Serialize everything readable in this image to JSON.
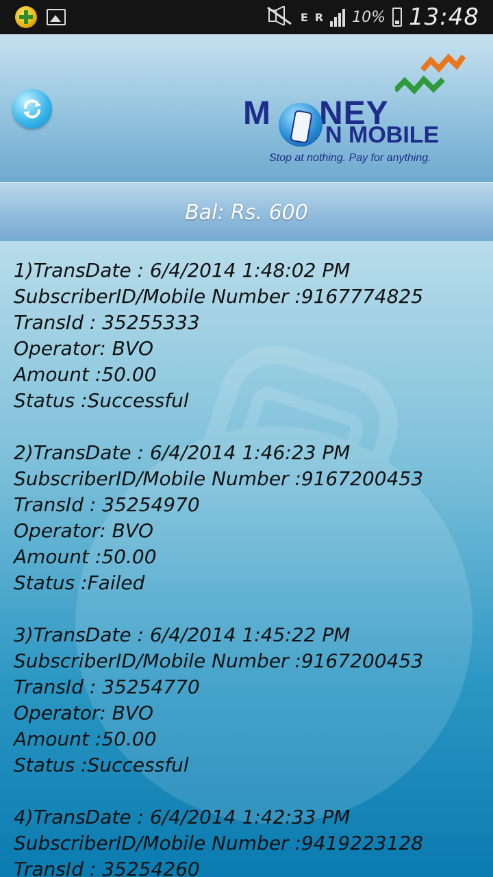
{
  "status_bar": {
    "time": "13:48",
    "battery_percent": "10%",
    "network_label": "E",
    "roaming_label": "R",
    "icons": [
      "plus-badge-icon",
      "image-icon",
      "mute-icon",
      "data-arrows-icon",
      "signal-icon",
      "battery-charging-icon"
    ]
  },
  "header": {
    "logo": {
      "word1_a": "M",
      "word1_b": "NEY",
      "word2": "N MOBILE",
      "tagline": "Stop at nothing. Pay for anything."
    },
    "refresh_icon": "refresh-icon"
  },
  "balance": {
    "text": "Bal: Rs. 600"
  },
  "transactions": [
    {
      "date": "1)TransDate : 6/4/2014 1:48:02 PM",
      "subscriber": "SubscriberID/Mobile Number :9167774825",
      "trans_id": "TransId : 35255333",
      "operator": "Operator: BVO",
      "amount": "Amount :50.00",
      "status": "Status :Successful"
    },
    {
      "date": "2)TransDate : 6/4/2014 1:46:23 PM",
      "subscriber": "SubscriberID/Mobile Number :9167200453",
      "trans_id": "TransId : 35254970",
      "operator": "Operator: BVO",
      "amount": "Amount :50.00",
      "status": "Status :Failed"
    },
    {
      "date": "3)TransDate : 6/4/2014 1:45:22 PM",
      "subscriber": "SubscriberID/Mobile Number :9167200453",
      "trans_id": "TransId : 35254770",
      "operator": "Operator: BVO",
      "amount": "Amount :50.00",
      "status": "Status :Successful"
    },
    {
      "date": "4)TransDate : 6/4/2014 1:42:33 PM",
      "subscriber": "SubscriberID/Mobile Number :9419223128",
      "trans_id": "TransId : 35254260"
    }
  ],
  "colors": {
    "status_bar_bg": "#141414",
    "logo_text": "#1e2c8a",
    "arrow_orange": "#e8761c",
    "arrow_green": "#2e9a3c",
    "content_bottom": "#0a7bb0"
  }
}
